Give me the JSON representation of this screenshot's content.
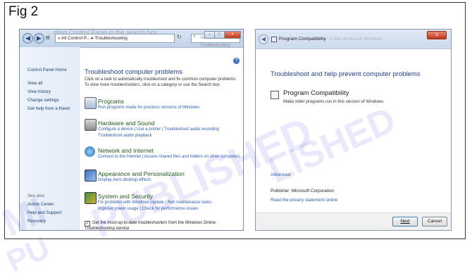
{
  "figure": {
    "label": "Fig 2"
  },
  "watermark": {
    "line1": "MI",
    "line2": "PUBLISHED",
    "line3": "PU",
    "line4": "LISHED"
  },
  "left_window": {
    "title_ghost": "...oting Control Panel in the search box.",
    "address": "« All Control P... ▸ Troubleshooting",
    "search_placeholder": "Search Troubleshooting",
    "sidebar": {
      "home": "Control Panel Home",
      "items": [
        "View all",
        "View history",
        "Change settings",
        "Get help from a friend"
      ],
      "see_also": "See also",
      "see_items": [
        "Action Center",
        "Help and Support",
        "Recovery"
      ]
    },
    "heading": "Troubleshoot computer problems",
    "description": "Click on a task to automatically troubleshoot and fix common computer problems. To view more troubleshooters, click on a category or use the Search box.",
    "categories": [
      {
        "title": "Programs",
        "links": [
          "Run programs made for previous versions of Windows"
        ]
      },
      {
        "title": "Hardware and Sound",
        "links": [
          "Configure a device  |  Use a printer  |  Troubleshoot audio recording",
          "Troubleshoot audio playback"
        ]
      },
      {
        "title": "Network and Internet",
        "links": [
          "Connect to the Internet  |  Access shared files and folders on other computers"
        ]
      },
      {
        "title": "Appearance and Personalization",
        "links": [
          "Display Aero desktop effects"
        ]
      },
      {
        "title": "System and Security",
        "links": [
          "Fix problems with Windows Update  |  Run maintenance tasks",
          "Improve power usage  |  Check for performance issues"
        ]
      }
    ],
    "checkbox_label": "Get the most up-to-date troubleshooters from the Windows Online Troubleshooting service"
  },
  "right_window": {
    "title": "Program Compatibility",
    "title_ghost": "in this version of Windows",
    "close_glyph": "x",
    "heading": "Troubleshoot and help prevent computer problems",
    "item_title": "Program Compatibility",
    "item_desc": "Make older programs run in this version of Windows.",
    "advanced": "Advanced",
    "publisher": "Publisher:  Microsoft Corporation",
    "privacy": "Read the privacy statement online",
    "next_button": "Next",
    "cancel_button": "Cancel"
  },
  "colors": {
    "accent_blue": "#1e3f8a",
    "link_blue": "#2a5db0",
    "category_green": "#1e5a1e",
    "watermark": "#2828dc"
  }
}
